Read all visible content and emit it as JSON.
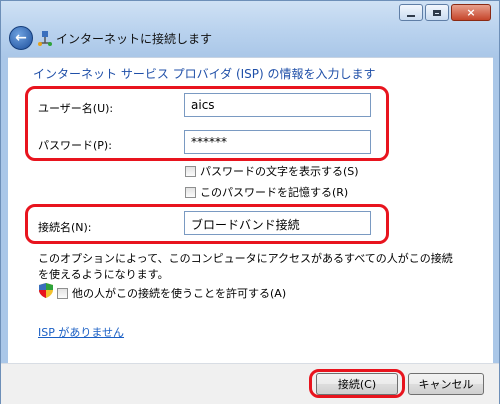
{
  "window": {
    "title": "インターネットに接続します",
    "controls": {
      "min": "minimize",
      "max": "maximize",
      "close": "×"
    }
  },
  "main": {
    "heading": "インターネット サービス プロバイダ (ISP) の情報を入力します",
    "username": {
      "label": "ユーザー名(U):",
      "value": "aics"
    },
    "password": {
      "label": "パスワード(P):",
      "value": "******"
    },
    "show_password": {
      "label": "パスワードの文字を表示する(S)",
      "checked": false
    },
    "remember_password": {
      "label": "このパスワードを記憶する(R)",
      "checked": false
    },
    "connection_name": {
      "label": "接続名(N):",
      "value": "ブロードバンド接続"
    },
    "description": "このオプションによって、このコンピュータにアクセスがあるすべての人がこの接続を使えるようになります。",
    "allow_others": {
      "label": "他の人がこの接続を使うことを許可する(A)",
      "checked": false
    },
    "no_isp_link": "ISP がありません"
  },
  "footer": {
    "connect_label": "接続(C)",
    "cancel_label": "キャンセル"
  },
  "colors": {
    "accent": "#1f4fa8",
    "highlight": "#e8141e",
    "link": "#1a5fc4"
  }
}
